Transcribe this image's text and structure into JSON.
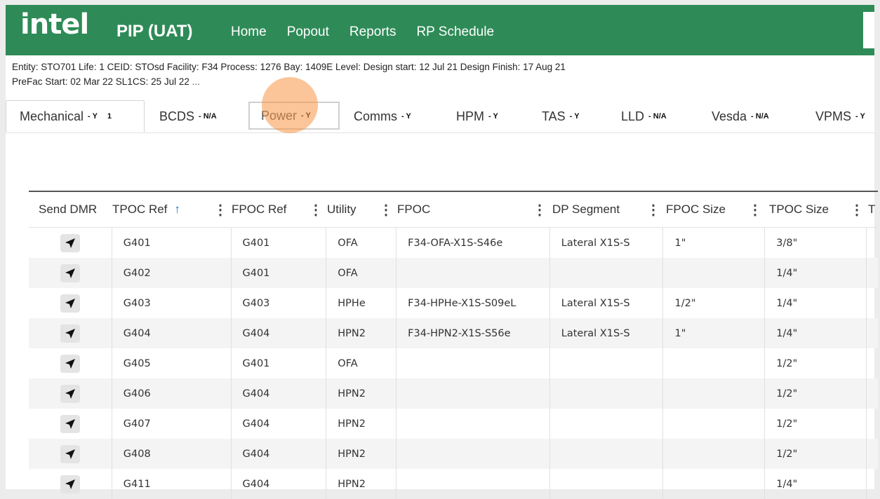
{
  "header": {
    "logo": "intel",
    "title": "PIP (UAT)",
    "nav": [
      "Home",
      "Popout",
      "Reports",
      "RP Schedule"
    ]
  },
  "info": {
    "line1": "Entity: STO701  Life: 1  CEID: STOsd  Facility: F34  Process: 1276  Bay: 1409E  Level:  Design start: 12 Jul 21  Design Finish: 17 Aug 21",
    "line2": "PreFac Start: 02 Mar 22  SL1CS: 25 Jul 22",
    "more": "..."
  },
  "tabs": [
    {
      "label": "Mechanical",
      "flag": "- Y",
      "count": "1"
    },
    {
      "label": "BCDS",
      "flag": "- N/A"
    },
    {
      "label": "Power",
      "flag": "- Y"
    },
    {
      "label": "Comms",
      "flag": "- Y"
    },
    {
      "label": "HPM",
      "flag": "- Y"
    },
    {
      "label": "TAS",
      "flag": "- Y"
    },
    {
      "label": "LLD",
      "flag": "- N/A"
    },
    {
      "label": "Vesda",
      "flag": "- N/A"
    },
    {
      "label": "VPMS",
      "flag": "- Y"
    }
  ],
  "table": {
    "columns": [
      "Send DMR",
      "TPOC Ref",
      "FPOC Ref",
      "Utility",
      "FPOC",
      "DP Segment",
      "FPOC Size",
      "TPOC Size",
      "T"
    ],
    "sort_icon": "↑",
    "rows": [
      [
        "G401",
        "G401",
        "OFA",
        "F34-OFA-X1S-S46e",
        "Lateral X1S-S",
        "1\"",
        "3/8\""
      ],
      [
        "G402",
        "G401",
        "OFA",
        "",
        "",
        "",
        "1/4\""
      ],
      [
        "G403",
        "G403",
        "HPHe",
        "F34-HPHe-X1S-S09eL",
        "Lateral X1S-S",
        "1/2\"",
        "1/4\""
      ],
      [
        "G404",
        "G404",
        "HPN2",
        "F34-HPN2-X1S-S56e",
        "Lateral X1S-S",
        "1\"",
        "1/4\""
      ],
      [
        "G405",
        "G401",
        "OFA",
        "",
        "",
        "",
        "1/2\""
      ],
      [
        "G406",
        "G404",
        "HPN2",
        "",
        "",
        "",
        "1/2\""
      ],
      [
        "G407",
        "G404",
        "HPN2",
        "",
        "",
        "",
        "1/2\""
      ],
      [
        "G408",
        "G404",
        "HPN2",
        "",
        "",
        "",
        "1/2\""
      ],
      [
        "G411",
        "G404",
        "HPN2",
        "",
        "",
        "",
        "1/4\""
      ]
    ]
  },
  "colors": {
    "header_bg": "#2e8b57",
    "cursor": "#f79646",
    "sort_arrow": "#1f6fd1"
  },
  "icons": {
    "send": "send-icon",
    "menu": "column-menu-icon"
  }
}
